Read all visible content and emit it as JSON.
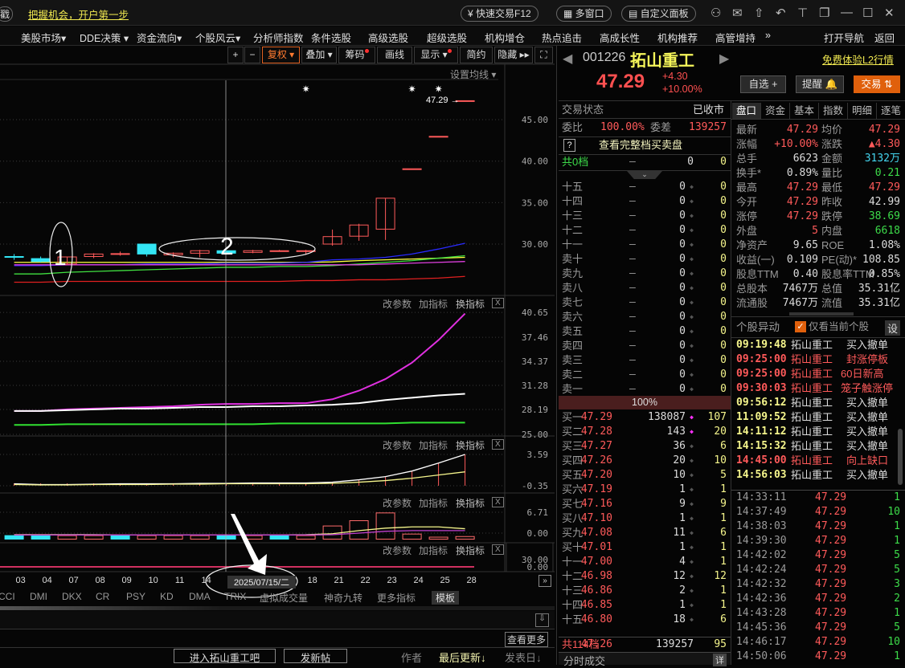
{
  "topbar": {
    "left_fragment": "戳",
    "promo_link": "把握机会，开户第一步",
    "quick_trade": "快速交易F12",
    "multi_window": "多窗口",
    "custom_panel": "自定义面板",
    "icons": [
      "user-icon",
      "mail-icon",
      "home-up-icon",
      "undo-icon",
      "skin-icon",
      "window-restore-icon",
      "minimize-icon",
      "maximize-icon",
      "close-icon"
    ],
    "icon_glyphs": [
      "⚇",
      "✉",
      "⇧",
      "↶",
      "⊤",
      "❐",
      "—",
      "☐",
      "✕"
    ]
  },
  "menu": {
    "items": [
      "美股市场▾",
      "DDE决策 ▾",
      "资金流向▾",
      "个股风云▾",
      "分析师指数",
      "条件选股",
      "高级选股",
      "超级选股",
      "机构增仓",
      "热点追击",
      "高成长性",
      "机构推荐",
      "高管增持",
      "»"
    ],
    "open_nav": "打开导航",
    "back": "返回"
  },
  "chart_toolbar": {
    "plus": "+",
    "minus": "−",
    "fuquan": "复权 ▾",
    "overlay": "叠加 ▾",
    "chips": "筹码",
    "draw": "画线",
    "display": "显示 ▾",
    "simple": "简约",
    "hide": "隐藏 ▸▸",
    "fullscreen": "⛶"
  },
  "kline": {
    "set_ma": "设置均线 ▾",
    "last_price_label": "47.29 →",
    "y_ticks": [
      "45.00",
      "40.00",
      "35.00",
      "30.00"
    ],
    "annotation_1": "1",
    "annotation_2": "2",
    "colors": {
      "up": "#ff5a5a",
      "down": "#33e6f5"
    },
    "candles": [
      {
        "o": 28.5,
        "h": 28.8,
        "l": 28.1,
        "c": 28.45
      },
      {
        "o": 28.25,
        "h": 28.5,
        "l": 27.8,
        "c": 27.9
      },
      {
        "o": 27.6,
        "h": 28.45,
        "l": 27.5,
        "c": 28.45
      },
      {
        "o": 28.5,
        "h": 28.9,
        "l": 28.3,
        "c": 28.8
      },
      {
        "o": 28.85,
        "h": 29.1,
        "l": 28.6,
        "c": 28.85
      },
      {
        "o": 30.0,
        "h": 30.0,
        "l": 28.5,
        "c": 28.8
      },
      {
        "o": 28.7,
        "h": 29.0,
        "l": 28.4,
        "c": 28.9
      },
      {
        "o": 28.9,
        "h": 29.3,
        "l": 28.4,
        "c": 29.2
      },
      {
        "o": 29.2,
        "h": 29.2,
        "l": 28.9,
        "c": 28.9
      },
      {
        "o": 29.0,
        "h": 29.3,
        "l": 28.9,
        "c": 29.2
      },
      {
        "o": 29.2,
        "h": 29.3,
        "l": 29.1,
        "c": 29.2
      },
      {
        "o": 29.2,
        "h": 29.3,
        "l": 28.7,
        "c": 29.2
      },
      {
        "o": 30.0,
        "h": 31.75,
        "l": 29.8,
        "c": 30.9
      },
      {
        "o": 30.95,
        "h": 32.45,
        "l": 30.4,
        "c": 32.3
      },
      {
        "o": 31.8,
        "h": 35.53,
        "l": 30.5,
        "c": 35.53
      },
      {
        "o": 39.08,
        "h": 39.08,
        "l": 39.08,
        "c": 39.08
      },
      {
        "o": 42.99,
        "h": 42.99,
        "l": 42.99,
        "c": 42.99
      },
      {
        "o": 47.29,
        "h": 47.29,
        "l": 47.29,
        "c": 47.29
      }
    ],
    "star_marks": [
      11,
      15,
      16
    ],
    "ma": [
      {
        "color": "#ffff40",
        "values": [
          27.8,
          27.8,
          27.8,
          27.8,
          27.8,
          27.8,
          27.8,
          27.8,
          27.8,
          27.8,
          27.8,
          27.8,
          27.85,
          28.0,
          28.1,
          28.2,
          28.3,
          28.4
        ]
      },
      {
        "color": "#2a2aff",
        "values": [
          27.4,
          27.4,
          27.5,
          27.5,
          27.5,
          27.6,
          27.6,
          27.6,
          27.7,
          27.7,
          27.7,
          27.8,
          28.1,
          28.2,
          28.4,
          28.8,
          29.4,
          30.1
        ]
      },
      {
        "color": "#40e040",
        "values": [
          26.4,
          26.4,
          26.6,
          26.7,
          26.8,
          26.9,
          27.0,
          27.1,
          27.2,
          27.2,
          27.3,
          27.3,
          27.4,
          27.6,
          27.8,
          28.0,
          28.3,
          28.6
        ]
      },
      {
        "color": "#e040e0",
        "values": [
          27.5,
          27.5,
          27.5,
          27.5,
          27.5,
          27.5,
          27.5,
          27.5,
          27.5,
          27.5,
          27.5,
          27.5,
          27.5,
          27.5,
          27.6,
          27.7,
          27.8,
          27.9
        ]
      },
      {
        "color": "#e02020",
        "values": [
          25.4,
          25.4,
          25.5,
          25.5,
          25.5,
          25.5,
          25.5,
          25.5,
          25.5,
          25.5,
          25.5,
          25.6,
          25.6,
          25.7,
          25.7,
          25.8,
          25.9,
          26.1
        ]
      }
    ]
  },
  "panel_tools": {
    "edit_params": "改参数",
    "add_indicator": "加指标",
    "switch_indicator": "换指标",
    "close": "X"
  },
  "panel2": {
    "y_ticks": [
      "40.65",
      "37.46",
      "34.37",
      "31.28",
      "28.19",
      "25.00"
    ],
    "lines": [
      {
        "color": "#e030e0",
        "values": [
          28.0,
          28.0,
          28.2,
          28.3,
          28.4,
          28.5,
          28.6,
          28.8,
          28.9,
          28.9,
          29.0,
          29.0,
          29.5,
          30.6,
          32.1,
          34.2,
          37.1,
          40.5
        ]
      },
      {
        "color": "#ffffff",
        "values": [
          28.0,
          28.0,
          28.1,
          28.2,
          28.3,
          28.3,
          28.4,
          28.5,
          28.5,
          28.6,
          28.6,
          28.7,
          28.8,
          29.0,
          29.4,
          29.7,
          30.0,
          30.2
        ]
      },
      {
        "color": "#30e030",
        "values": [
          26.2,
          26.2,
          26.3,
          26.3,
          26.3,
          26.3,
          26.3,
          26.3,
          26.3,
          26.3,
          26.4,
          26.4,
          26.4,
          26.4,
          26.4,
          26.5,
          26.5,
          26.5
        ]
      }
    ]
  },
  "panel3": {
    "y_ticks": [
      "3.59",
      "-0.35"
    ],
    "lines": [
      {
        "color": "#ffffff",
        "values": [
          -0.1,
          -0.2,
          -0.2,
          -0.15,
          -0.1,
          -0.1,
          -0.1,
          -0.05,
          -0.05,
          0.0,
          0.0,
          0.0,
          0.1,
          0.4,
          0.8,
          1.5,
          2.5,
          3.59
        ]
      },
      {
        "color": "#f5f58c",
        "values": [
          -0.2,
          -0.25,
          -0.25,
          -0.2,
          -0.2,
          -0.2,
          -0.15,
          -0.15,
          -0.1,
          -0.1,
          -0.1,
          -0.1,
          -0.05,
          0.1,
          0.3,
          0.6,
          1.0,
          1.4
        ]
      }
    ],
    "bars": [
      0,
      0,
      0,
      0,
      0,
      0,
      0,
      0,
      0,
      0,
      0,
      0,
      0.1,
      0.4,
      0.8,
      1.5,
      2.5,
      3.59
    ]
  },
  "panel4": {
    "y_ticks": [
      "6.71",
      "0.00"
    ],
    "bars": [
      -0.8,
      -0.8,
      -0.8,
      -0.8,
      -0.8,
      -0.8,
      -0.8,
      -0.8,
      -0.8,
      -0.8,
      -0.8,
      -0.8,
      2.3,
      4.0,
      6.5,
      -0.3,
      -1.3,
      -1.1
    ],
    "bar_kind": [
      "down",
      "down",
      "up",
      "up",
      "down",
      "up",
      "up",
      "up",
      "down",
      "up",
      "down",
      "up",
      "up",
      "up",
      "up",
      "up",
      "up",
      "up"
    ],
    "lines": [
      {
        "color": "#f5f58c",
        "values": [
          -0.5,
          -0.5,
          -0.5,
          -0.5,
          -0.6,
          -0.6,
          -0.6,
          -0.6,
          -0.6,
          -0.6,
          -0.6,
          -0.5,
          -0.2,
          0.8,
          1.6,
          2.0,
          2.0,
          1.4
        ]
      },
      {
        "color": "#c040d0",
        "values": [
          -0.6,
          -0.6,
          -0.6,
          -0.6,
          -0.6,
          -0.6,
          -0.6,
          -0.6,
          -0.6,
          -0.6,
          -0.6,
          -0.6,
          -0.5,
          0.0,
          0.6,
          0.8,
          0.8,
          0.8
        ]
      }
    ]
  },
  "panel5": {
    "y_ticks": [
      "30.00",
      "0.00"
    ]
  },
  "dates": [
    "03",
    "04",
    "07",
    "08",
    "09",
    "10",
    "11",
    "14",
    "2025/07/15/二",
    "18",
    "21",
    "22",
    "23",
    "24",
    "25",
    "28"
  ],
  "indicator_tabs": [
    "CCI",
    "DMI",
    "DKX",
    "CR",
    "PSY",
    "KD",
    "DMA",
    "TRIX",
    "虚拟成交量",
    "神奇九转",
    "更多指标",
    "模板"
  ],
  "forum": {
    "view_more": "查看更多",
    "enter_bar": "进入拓山重工吧",
    "new_post": "发新帖",
    "author": "作者",
    "last_update": "最后更新↓",
    "post_date": "发表日↓"
  },
  "stock": {
    "code": "001226",
    "name": "拓山重工",
    "l2_link": "免费体验L2行情",
    "price": "47.29",
    "change": "+4.30",
    "change_pct": "+10.00%",
    "watchlist": "自选 +",
    "alert": "提醒 🔔",
    "trade": "交易 ⇅"
  },
  "orderbook": {
    "status_label": "交易状态",
    "status_value": "已收市",
    "ratio_label": "委比",
    "ratio_value": "100.00%",
    "diff_label": "委差",
    "diff_value": "139257",
    "help": "?",
    "full_depth": "查看完整档买卖盘",
    "ask_total": {
      "label": "共0档",
      "price": "—",
      "vol": "0",
      "count": "0"
    },
    "asks": [
      {
        "label": "十五",
        "price": "—",
        "vol": "0",
        "count": "0"
      },
      {
        "label": "十四",
        "price": "—",
        "vol": "0",
        "count": "0"
      },
      {
        "label": "十三",
        "price": "—",
        "vol": "0",
        "count": "0"
      },
      {
        "label": "十二",
        "price": "—",
        "vol": "0",
        "count": "0"
      },
      {
        "label": "十一",
        "price": "—",
        "vol": "0",
        "count": "0"
      },
      {
        "label": "卖十",
        "price": "—",
        "vol": "0",
        "count": "0"
      },
      {
        "label": "卖九",
        "price": "—",
        "vol": "0",
        "count": "0"
      },
      {
        "label": "卖八",
        "price": "—",
        "vol": "0",
        "count": "0"
      },
      {
        "label": "卖七",
        "price": "—",
        "vol": "0",
        "count": "0"
      },
      {
        "label": "卖六",
        "price": "—",
        "vol": "0",
        "count": "0"
      },
      {
        "label": "卖五",
        "price": "—",
        "vol": "0",
        "count": "0"
      },
      {
        "label": "卖四",
        "price": "—",
        "vol": "0",
        "count": "0"
      },
      {
        "label": "卖三",
        "price": "—",
        "vol": "0",
        "count": "0"
      },
      {
        "label": "卖二",
        "price": "—",
        "vol": "0",
        "count": "0"
      },
      {
        "label": "卖一",
        "price": "—",
        "vol": "0",
        "count": "0"
      }
    ],
    "bid_pct": "100%",
    "bids": [
      {
        "label": "买一",
        "price": "47.29",
        "vol": "138087",
        "count": "107",
        "hl": true
      },
      {
        "label": "买二",
        "price": "47.28",
        "vol": "143",
        "count": "20",
        "hl": true
      },
      {
        "label": "买三",
        "price": "47.27",
        "vol": "36",
        "count": "6"
      },
      {
        "label": "买四",
        "price": "47.26",
        "vol": "20",
        "count": "10"
      },
      {
        "label": "买五",
        "price": "47.20",
        "vol": "10",
        "count": "5"
      },
      {
        "label": "买六",
        "price": "47.19",
        "vol": "1",
        "count": "1"
      },
      {
        "label": "买七",
        "price": "47.16",
        "vol": "9",
        "count": "9"
      },
      {
        "label": "买八",
        "price": "47.10",
        "vol": "1",
        "count": "1"
      },
      {
        "label": "买九",
        "price": "47.08",
        "vol": "11",
        "count": "6"
      },
      {
        "label": "买十",
        "price": "47.01",
        "vol": "1",
        "count": "1"
      },
      {
        "label": "十一",
        "price": "47.00",
        "vol": "4",
        "count": "1"
      },
      {
        "label": "十二",
        "price": "46.98",
        "vol": "12",
        "count": "12"
      },
      {
        "label": "十三",
        "price": "46.86",
        "vol": "2",
        "count": "1"
      },
      {
        "label": "十四",
        "price": "46.85",
        "vol": "1",
        "count": "1"
      },
      {
        "label": "十五",
        "price": "46.80",
        "vol": "18",
        "count": "6"
      }
    ],
    "bid_total": {
      "label": "共114档",
      "price": "47.26",
      "vol": "139257",
      "count": "95"
    },
    "tick_title": "分时成交",
    "tick_detail": "详"
  },
  "quote": {
    "tabs": [
      "盘口",
      "资金",
      "基本",
      "指数",
      "明细",
      "逐笔"
    ],
    "rows": [
      [
        [
          "最新",
          "47.29",
          "r"
        ],
        [
          "均价",
          "47.29",
          "r"
        ]
      ],
      [
        [
          "涨幅",
          "+10.00%",
          "r"
        ],
        [
          "涨跌",
          "▲4.30",
          "r"
        ]
      ],
      [
        [
          "总手",
          "6623",
          "w"
        ],
        [
          "金额",
          "3132万",
          "c"
        ]
      ],
      [
        [
          "换手*",
          "0.89%",
          "w"
        ],
        [
          "量比",
          "0.21",
          "g"
        ]
      ],
      [
        [
          "最高",
          "47.29",
          "r"
        ],
        [
          "最低",
          "47.29",
          "r"
        ]
      ],
      [
        [
          "今开",
          "47.29",
          "r"
        ],
        [
          "昨收",
          "42.99",
          "w"
        ]
      ],
      [
        [
          "涨停",
          "47.29",
          "r"
        ],
        [
          "跌停",
          "38.69",
          "g"
        ]
      ],
      [
        [
          "外盘",
          "5",
          "r"
        ],
        [
          "内盘",
          "6618",
          "g"
        ]
      ],
      [
        [
          "净资产",
          "9.65",
          "w"
        ],
        [
          "ROE",
          "1.08%",
          "w"
        ]
      ],
      [
        [
          "收益(一)",
          "0.109",
          "w"
        ],
        [
          "PE(动)*",
          "108.85",
          "w"
        ]
      ],
      [
        [
          "股息TTM",
          "0.40",
          "w"
        ],
        [
          "股息率TTM",
          "0.85%",
          "w"
        ]
      ],
      [
        [
          "总股本",
          "7467万",
          "w"
        ],
        [
          "总值",
          "35.31亿",
          "w"
        ]
      ],
      [
        [
          "流通股",
          "7467万",
          "w"
        ],
        [
          "流值",
          "35.31亿",
          "w"
        ]
      ]
    ]
  },
  "alerts": {
    "title": "个股异动",
    "only_current": "仅看当前个股",
    "settings": "设",
    "items": [
      {
        "time": "09:19:48",
        "name": "拓山重工",
        "event": "买入撤单",
        "hot": false
      },
      {
        "time": "09:25:00",
        "name": "拓山重工",
        "event": "封涨停板",
        "hot": true
      },
      {
        "time": "09:25:00",
        "name": "拓山重工",
        "event": "60日新高",
        "hot": true
      },
      {
        "time": "09:30:03",
        "name": "拓山重工",
        "event": "笼子触涨停",
        "hot": true
      },
      {
        "time": "09:56:12",
        "name": "拓山重工",
        "event": "买入撤单",
        "hot": false
      },
      {
        "time": "11:09:52",
        "name": "拓山重工",
        "event": "买入撤单",
        "hot": false
      },
      {
        "time": "14:11:12",
        "name": "拓山重工",
        "event": "买入撤单",
        "hot": false
      },
      {
        "time": "14:15:32",
        "name": "拓山重工",
        "event": "买入撤单",
        "hot": false
      },
      {
        "time": "14:45:00",
        "name": "拓山重工",
        "event": "向上缺口",
        "hot": true
      },
      {
        "time": "14:56:03",
        "name": "拓山重工",
        "event": "买入撤单",
        "hot": false
      }
    ]
  },
  "trades": [
    {
      "time": "14:33:11",
      "price": "47.29",
      "vol": "1"
    },
    {
      "time": "14:37:49",
      "price": "47.29",
      "vol": "10"
    },
    {
      "time": "14:38:03",
      "price": "47.29",
      "vol": "1"
    },
    {
      "time": "14:39:30",
      "price": "47.29",
      "vol": "1"
    },
    {
      "time": "14:42:02",
      "price": "47.29",
      "vol": "5"
    },
    {
      "time": "14:42:24",
      "price": "47.29",
      "vol": "5"
    },
    {
      "time": "14:42:32",
      "price": "47.29",
      "vol": "3"
    },
    {
      "time": "14:42:36",
      "price": "47.29",
      "vol": "2"
    },
    {
      "time": "14:43:28",
      "price": "47.29",
      "vol": "1"
    },
    {
      "time": "14:45:36",
      "price": "47.29",
      "vol": "5"
    },
    {
      "time": "14:46:17",
      "price": "47.29",
      "vol": "10"
    },
    {
      "time": "14:50:06",
      "price": "47.29",
      "vol": "1"
    }
  ]
}
